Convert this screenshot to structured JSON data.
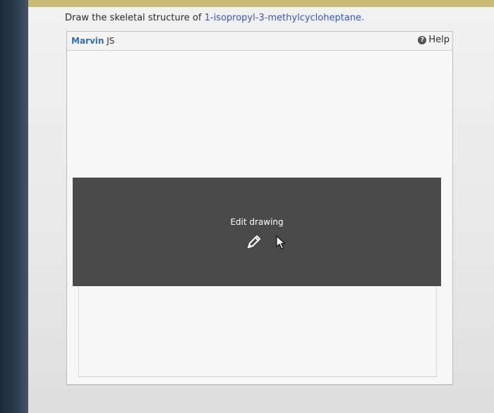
{
  "question": {
    "prefix": "Draw the skeletal structure of",
    "compound": "1-isopropyl-3-methylcycloheptane."
  },
  "editor": {
    "brand_name": "Marvin",
    "brand_suffix": "JS",
    "help_label": "Help",
    "help_icon_glyph": "?",
    "overlay_label": "Edit drawing"
  },
  "icons": {
    "help": "question-circle-icon",
    "edit": "pencil-icon",
    "cursor": "mouse-cursor-icon"
  },
  "colors": {
    "compound_text": "#3b57a8",
    "brand": "#2d6fb3",
    "overlay_bg": "#4a4a4a",
    "top_strip": "#c9bc79"
  }
}
